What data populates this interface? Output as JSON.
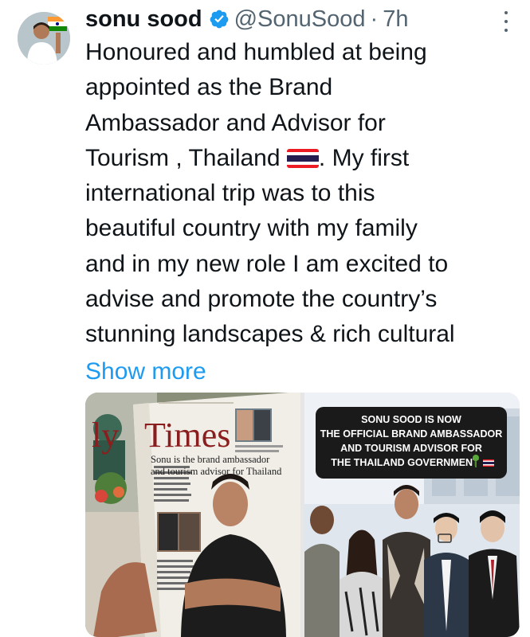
{
  "author": {
    "name": "sonu sood",
    "handle": "@SonuSood",
    "separator": "·",
    "time": "7h"
  },
  "tweet": {
    "lines": [
      "Honoured and humbled at being",
      "appointed as the Brand",
      "Ambassador and Advisor for",
      "Tourism , Thailand",
      ". My first",
      "international trip was to this",
      "beautiful country with my family",
      "and in my new role I am excited to",
      "advise and promote the country’s",
      "stunning landscapes & rich cultural"
    ],
    "show_more": "Show more"
  },
  "media": {
    "left": {
      "masthead": "Times",
      "masthead_prefix": "ly",
      "headline_line1": "Sonu is the brand ambassador",
      "headline_line2": "and tourism advisor for Thailand"
    },
    "right": {
      "banner_lines": [
        "SONU SOOD IS NOW",
        "THE OFFICIAL BRAND AMBASSADOR",
        "AND TOURISM ADVISOR FOR",
        "THE THAILAND GOVERNMENT"
      ]
    }
  },
  "colors": {
    "link": "#1d9bf0",
    "verified": "#1d9bf0",
    "secondary_text": "#536471",
    "thai_flag_red": "#ed1c24",
    "thai_flag_blue": "#241d4f"
  },
  "icons": [
    "verified-badge-icon",
    "more-options-icon",
    "thailand-flag-icon"
  ]
}
